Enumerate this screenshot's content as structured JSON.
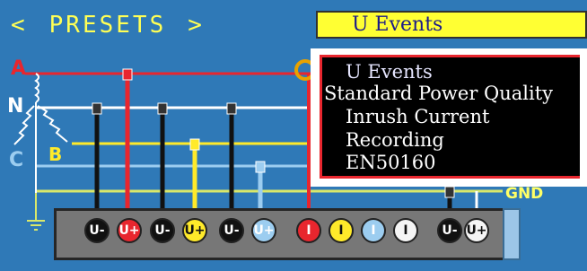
{
  "header": {
    "prev_arrow": "<",
    "title": "PRESETS",
    "next_arrow": ">"
  },
  "preset_select": {
    "selected_value": "U Events"
  },
  "preset_menu": {
    "items": [
      "U Events",
      "Standard Power Quality",
      "Inrush Current",
      "Recording",
      "EN50160"
    ]
  },
  "phases": {
    "a": "A",
    "n": "N",
    "c": "C",
    "b": "B",
    "gnd": "GND"
  },
  "jacks": [
    {
      "label": "U-",
      "color": "#111111",
      "text_color": "#ffffff"
    },
    {
      "label": "U+",
      "color": "#e8262e",
      "text_color": "#ffffff"
    },
    {
      "label": "U-",
      "color": "#111111",
      "text_color": "#ffffff"
    },
    {
      "label": "U+",
      "color": "#ffea2a",
      "text_color": "#111111"
    },
    {
      "label": "U-",
      "color": "#111111",
      "text_color": "#ffffff"
    },
    {
      "label": "U+",
      "color": "#9ccdf0",
      "text_color": "#ffffff"
    },
    {
      "label": "I",
      "color": "#e8262e",
      "text_color": "#ffffff"
    },
    {
      "label": "I",
      "color": "#ffea2a",
      "text_color": "#111111"
    },
    {
      "label": "I",
      "color": "#9ccdf0",
      "text_color": "#ffffff"
    },
    {
      "label": "I",
      "color": "#f5f5f5",
      "text_color": "#111111"
    },
    {
      "label": "U-",
      "color": "#111111",
      "text_color": "#ffffff"
    },
    {
      "label": "U+",
      "color": "#f5f5f5",
      "text_color": "#111111"
    }
  ],
  "colors": {
    "background": "#2f79b7",
    "accent_yellow": "#ffff33",
    "phase_a": "#e8262e",
    "phase_b": "#ffea2a",
    "phase_c": "#9ccdf0",
    "neutral": "#ffffff",
    "menu_border": "#e8262e"
  }
}
